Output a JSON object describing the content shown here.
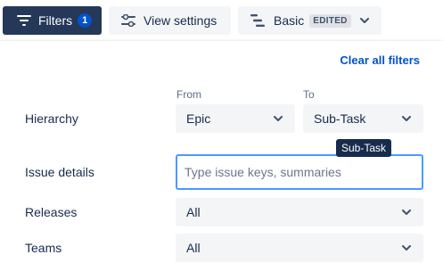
{
  "toolbar": {
    "filters_label": "Filters",
    "filters_count": "1",
    "view_settings_label": "View settings",
    "preset_label": "Basic",
    "preset_badge": "EDITED"
  },
  "panel": {
    "clear_all_label": "Clear all filters",
    "columns": {
      "from": "From",
      "to": "To"
    },
    "hierarchy": {
      "label": "Hierarchy",
      "from_value": "Epic",
      "to_value": "Sub-Task",
      "tooltip": "Sub-Task"
    },
    "issue_details": {
      "label": "Issue details",
      "placeholder": "Type issue keys, summaries"
    },
    "releases": {
      "label": "Releases",
      "value": "All"
    },
    "teams": {
      "label": "Teams",
      "value": "All"
    }
  },
  "icons": {
    "filters": "filter-icon",
    "view_settings": "settings-sliders-icon",
    "preset": "view-preset-icon",
    "dropdown": "chevron-down-icon"
  },
  "colors": {
    "primary_button_bg": "#253858",
    "badge_blue": "#0052CC",
    "focus_border": "#4C9AFF",
    "link": "#0052CC",
    "neutral_bg": "#F4F5F7"
  }
}
